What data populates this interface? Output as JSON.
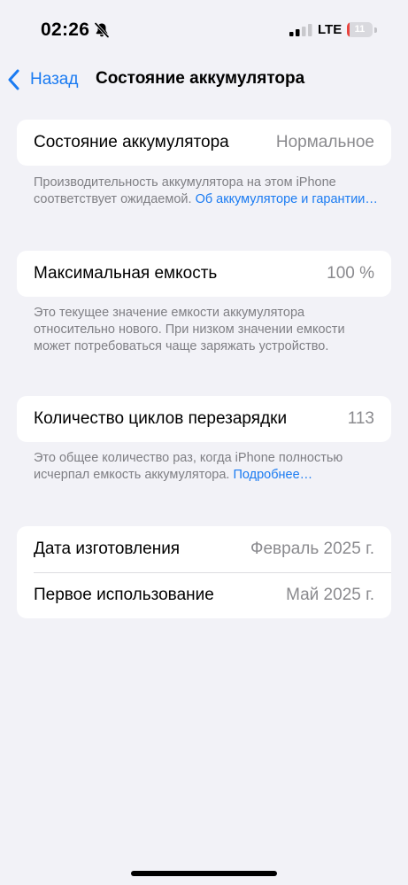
{
  "status_bar": {
    "time": "02:26",
    "network": "LTE",
    "battery_level": "11",
    "battery_fraction": 0.11,
    "battery_color": "#e9443f",
    "silent_icon": "bell-slash-icon",
    "signal_icon": "cellular-signal-icon",
    "signal_bars_active": 2
  },
  "nav": {
    "back_label": "Назад",
    "back_icon": "chevron-left-icon",
    "title": "Состояние аккумулятора"
  },
  "health": {
    "label": "Состояние аккумулятора",
    "value": "Нормальное",
    "note": "Производительность аккумулятора на этом iPhone соответствует ожидаемой.",
    "link": "Об аккумуляторе и гарантии…"
  },
  "capacity": {
    "label": "Максимальная емкость",
    "value": "100 %",
    "note": "Это текущее значение емкости аккумулятора относительно нового. При низком значении емкости может потребоваться чаще заряжать устройство."
  },
  "cycles": {
    "label": "Количество циклов перезарядки",
    "value": "113",
    "note": "Это общее количество раз, когда iPhone полностью исчерпал емкость аккумулятора.",
    "link": "Подробнее…"
  },
  "dates": {
    "manufacture_label": "Дата изготовления",
    "manufacture_value": "Февраль 2025 г.",
    "first_use_label": "Первое использование",
    "first_use_value": "Май 2025 г."
  },
  "colors": {
    "accent": "#1a7bf2",
    "background": "#f2f2f7",
    "secondary_text": "#8a8a8e"
  }
}
